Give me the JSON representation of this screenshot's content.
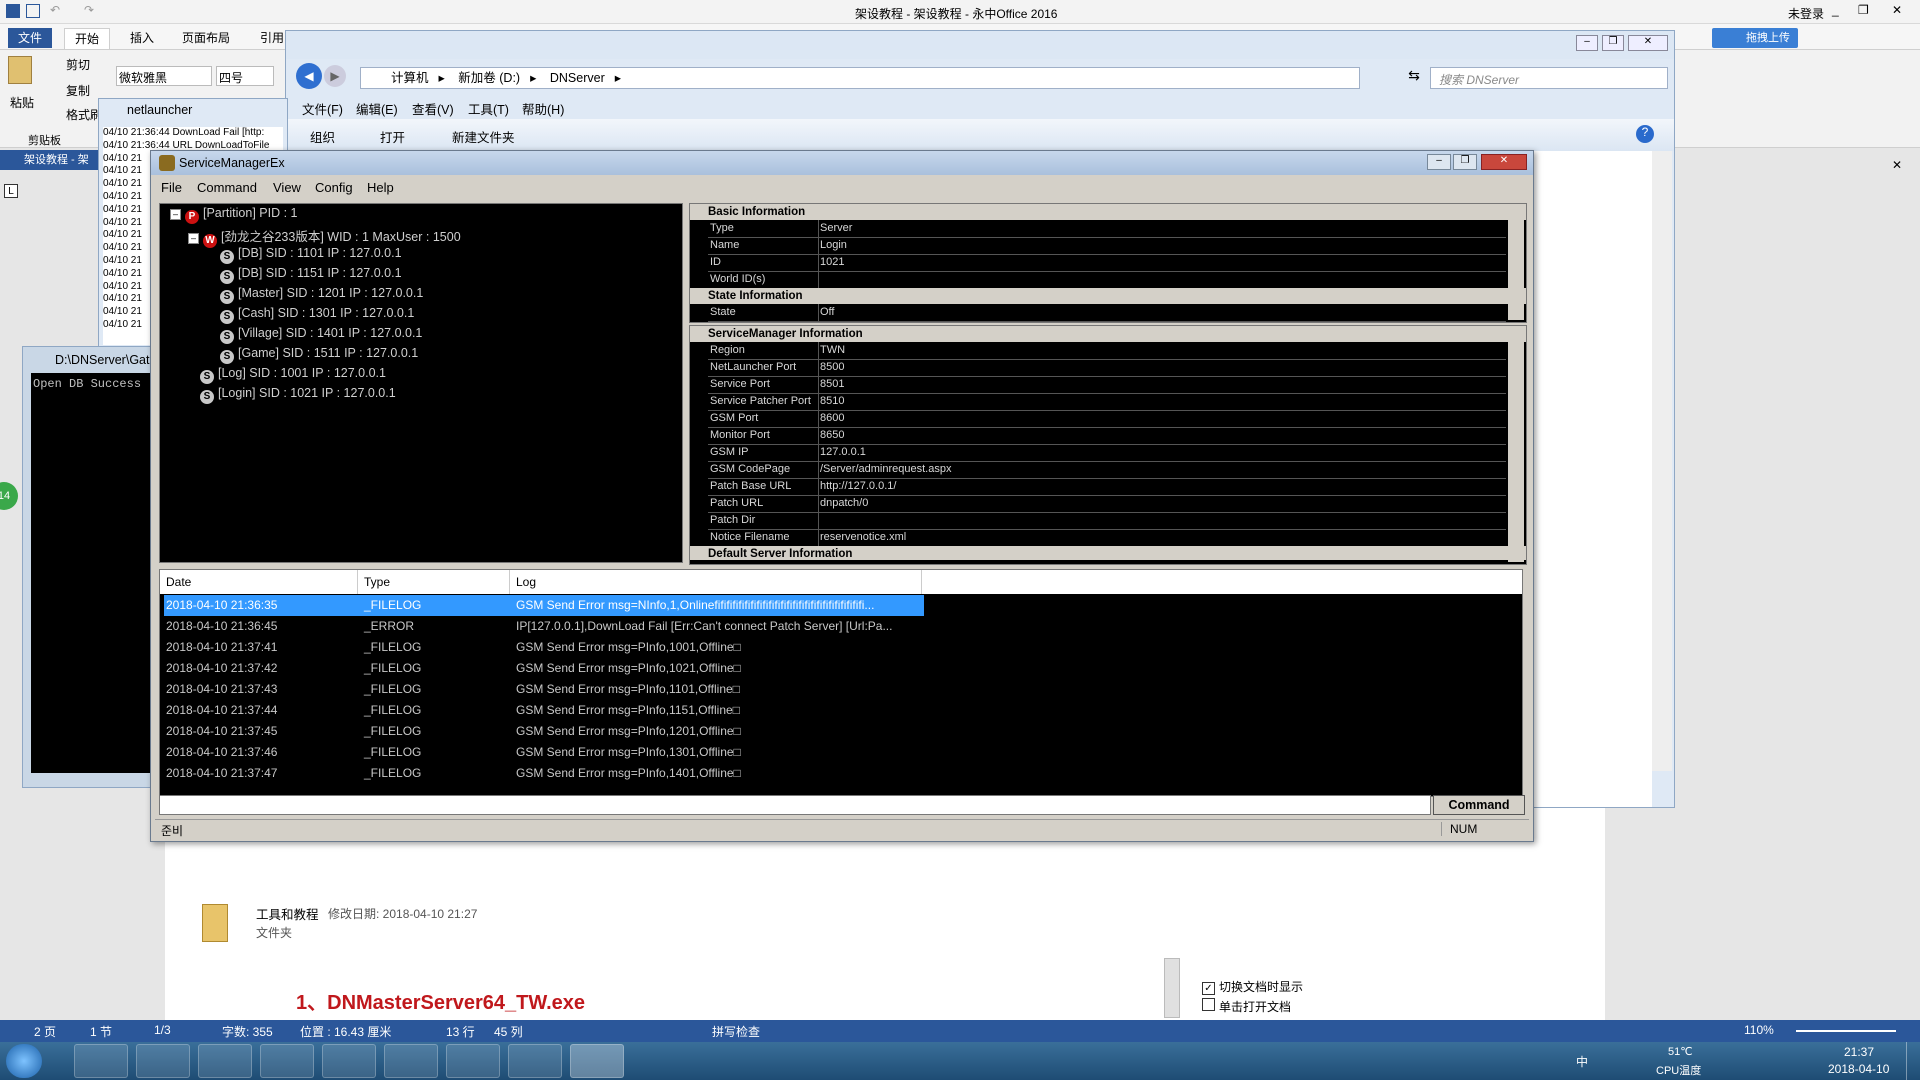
{
  "office": {
    "title": "架设教程 - 架设教程 - 永中Office 2016",
    "user": "未登录",
    "tabs": [
      "文件",
      "开始",
      "插入",
      "页面布局",
      "引用"
    ],
    "font": "微软雅黑",
    "size": "四号",
    "clipboard": {
      "paste": "粘贴",
      "cut": "剪切",
      "copy": "复制",
      "format": "格式刷",
      "group": "剪贴板"
    },
    "upload": "拖拽上传",
    "doc_tab": "架设教程 - 架",
    "heading": "1、DNMasterServer64_TW.exe",
    "folder_name": "工具和教程",
    "folder_date": "修改日期: 2018-04-10 21:27",
    "folder_type": "文件夹",
    "side_opt1": "切换文档时显示",
    "side_opt2": "单击打开文档",
    "status": {
      "pages": "2 页",
      "section": "1 节",
      "pos": "1/3",
      "words": "字数: 355",
      "position": "位置 : 16.43 厘米",
      "row": "13 行",
      "col": "45 列",
      "spell": "拼写检查",
      "zoom": "110%"
    }
  },
  "taskbar": {
    "temp": "51℃",
    "temp_label": "CPU温度",
    "time": "21:37",
    "date": "2018-04-10",
    "ime": "中"
  },
  "explorer": {
    "crumbs": [
      "计算机",
      "新加卷 (D:)",
      "DNServer"
    ],
    "search": "搜索 DNServer",
    "menu": [
      "文件(F)",
      "编辑(E)",
      "查看(V)",
      "工具(T)",
      "帮助(H)"
    ],
    "toolbar": [
      "组织",
      "打开",
      "新建文件夹"
    ]
  },
  "netlauncher": {
    "title": "netlauncher",
    "lines": [
      "04/10 21:36:44 DownLoad Fail [http:",
      "04/10 21:36:44 URL DownLoadToFile",
      "04/10 21",
      "04/10 21",
      "04/10 21",
      "04/10 21",
      "04/10 21",
      "04/10 21",
      "04/10 21",
      "04/10 21",
      "04/10 21",
      "04/10 21",
      "04/10 21",
      "04/10 21",
      "04/10 21",
      "04/10 21"
    ]
  },
  "console": {
    "title": "D:\\DNServer\\Gat",
    "text": "Open DB Success"
  },
  "smw": {
    "title": "ServiceManagerEx",
    "menu": [
      "File",
      "Command",
      "View",
      "Config",
      "Help"
    ],
    "tree": [
      {
        "label": "[Partition] PID : 1",
        "badge": "P"
      },
      {
        "label": "[劲龙之谷233版本] WID : 1 MaxUser : 1500",
        "badge": "W"
      },
      {
        "label": "[DB] SID : 1101 IP : 127.0.0.1",
        "badge": "S"
      },
      {
        "label": "[DB] SID : 1151 IP : 127.0.0.1",
        "badge": "S"
      },
      {
        "label": "[Master] SID : 1201 IP : 127.0.0.1",
        "badge": "S"
      },
      {
        "label": "[Cash] SID : 1301 IP : 127.0.0.1",
        "badge": "S"
      },
      {
        "label": "[Village] SID : 1401 IP : 127.0.0.1",
        "badge": "S"
      },
      {
        "label": "[Game] SID : 1511 IP : 127.0.0.1",
        "badge": "S"
      },
      {
        "label": "[Log] SID : 1001 IP : 127.0.0.1",
        "badge": "S"
      },
      {
        "label": "[Login] SID : 1021 IP : 127.0.0.1",
        "badge": "S"
      }
    ],
    "basic": {
      "title": "Basic Information",
      "rows": [
        [
          "Type",
          "Server"
        ],
        [
          "Name",
          "Login"
        ],
        [
          "ID",
          "1021"
        ],
        [
          "World ID(s)",
          ""
        ]
      ]
    },
    "state": {
      "title": "State Information",
      "rows": [
        [
          "State",
          "Off"
        ]
      ]
    },
    "sm": {
      "title": "ServiceManager Information",
      "rows": [
        [
          "Region",
          "TWN"
        ],
        [
          "NetLauncher Port",
          "8500"
        ],
        [
          "Service Port",
          "8501"
        ],
        [
          "Service Patcher Port",
          "8510"
        ],
        [
          "GSM Port",
          "8600"
        ],
        [
          "Monitor Port",
          "8650"
        ],
        [
          "GSM IP",
          "127.0.0.1"
        ],
        [
          "GSM CodePage",
          "/Server/adminrequest.aspx"
        ],
        [
          "Patch Base URL",
          "http://127.0.0.1/"
        ],
        [
          "Patch URL",
          "dnpatch/0"
        ],
        [
          "Patch Dir",
          ""
        ],
        [
          "Notice Filename",
          "reservenotice.xml"
        ]
      ]
    },
    "default_title": "Default Server Information",
    "log": {
      "headers": [
        "Date",
        "Type",
        "Log"
      ],
      "rows": [
        [
          "2018-04-10 21:36:35",
          "_FILELOG",
          "GSM Send Error msg=NInfo,1,Onlineﬁﬁﬁﬁﬁﬁﬁﬁﬁﬁﬁﬁﬁﬁﬁﬁﬁﬁﬁﬁﬁﬁﬁﬁﬁ..."
        ],
        [
          "2018-04-10 21:36:45",
          "_ERROR",
          "IP[127.0.0.1],DownLoad Fail [Err:Can't connect Patch Server] [Url:Pa..."
        ],
        [
          "2018-04-10 21:37:41",
          "_FILELOG",
          "GSM Send Error msg=PInfo,1001,Offline□"
        ],
        [
          "2018-04-10 21:37:42",
          "_FILELOG",
          "GSM Send Error msg=PInfo,1021,Offline□"
        ],
        [
          "2018-04-10 21:37:43",
          "_FILELOG",
          "GSM Send Error msg=PInfo,1101,Offline□"
        ],
        [
          "2018-04-10 21:37:44",
          "_FILELOG",
          "GSM Send Error msg=PInfo,1151,Offline□"
        ],
        [
          "2018-04-10 21:37:45",
          "_FILELOG",
          "GSM Send Error msg=PInfo,1201,Offline□"
        ],
        [
          "2018-04-10 21:37:46",
          "_FILELOG",
          "GSM Send Error msg=PInfo,1301,Offline□"
        ],
        [
          "2018-04-10 21:37:47",
          "_FILELOG",
          "GSM Send Error msg=PInfo,1401,Offline□"
        ]
      ]
    },
    "command_btn": "Command",
    "status_left": "준비",
    "status_right": "NUM"
  },
  "colors": {
    "accent": "#2b579a",
    "selection": "#3399ff"
  }
}
